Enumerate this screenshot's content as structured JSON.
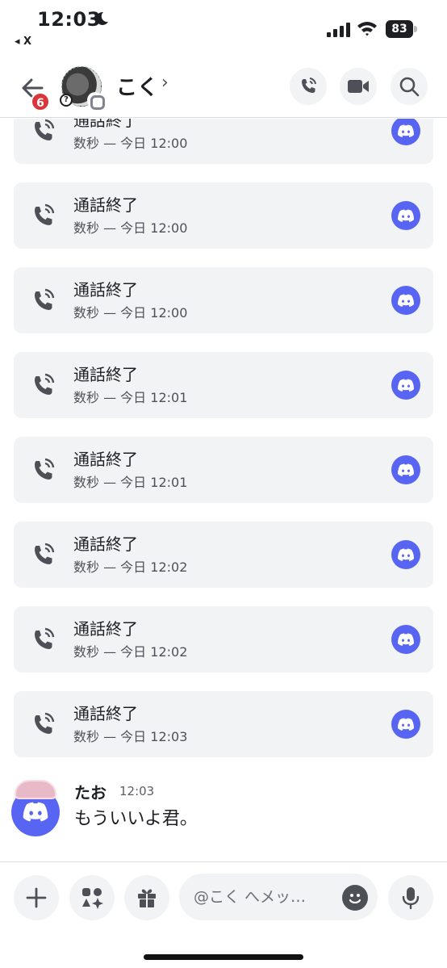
{
  "status_bar": {
    "time": "12:03",
    "back_app": "◂ X",
    "battery": "83"
  },
  "header": {
    "unread_badge": "6",
    "contact_name": "こく",
    "chevron": "›",
    "icons": [
      "back-arrow-icon",
      "voice-call-icon",
      "video-call-icon",
      "search-icon"
    ]
  },
  "calls": [
    {
      "title": "通話終了",
      "sub": "数秒 — 今日 12:00"
    },
    {
      "title": "通話終了",
      "sub": "数秒 — 今日 12:00"
    },
    {
      "title": "通話終了",
      "sub": "数秒 — 今日 12:00"
    },
    {
      "title": "通話終了",
      "sub": "数秒 — 今日 12:01"
    },
    {
      "title": "通話終了",
      "sub": "数秒 — 今日 12:01"
    },
    {
      "title": "通話終了",
      "sub": "数秒 — 今日 12:02"
    },
    {
      "title": "通話終了",
      "sub": "数秒 — 今日 12:02"
    },
    {
      "title": "通話終了",
      "sub": "数秒 — 今日 12:03"
    }
  ],
  "message": {
    "author": "たお",
    "time": "12:03",
    "text": "もういいよ君。"
  },
  "composer": {
    "placeholder": "@こく へメッ…",
    "icons": [
      "plus-icon",
      "apps-icon",
      "gift-icon",
      "emoji-icon",
      "microphone-icon"
    ]
  },
  "colors": {
    "accent": "#5865f2",
    "badge": "#da373c",
    "card": "#f2f3f5"
  }
}
